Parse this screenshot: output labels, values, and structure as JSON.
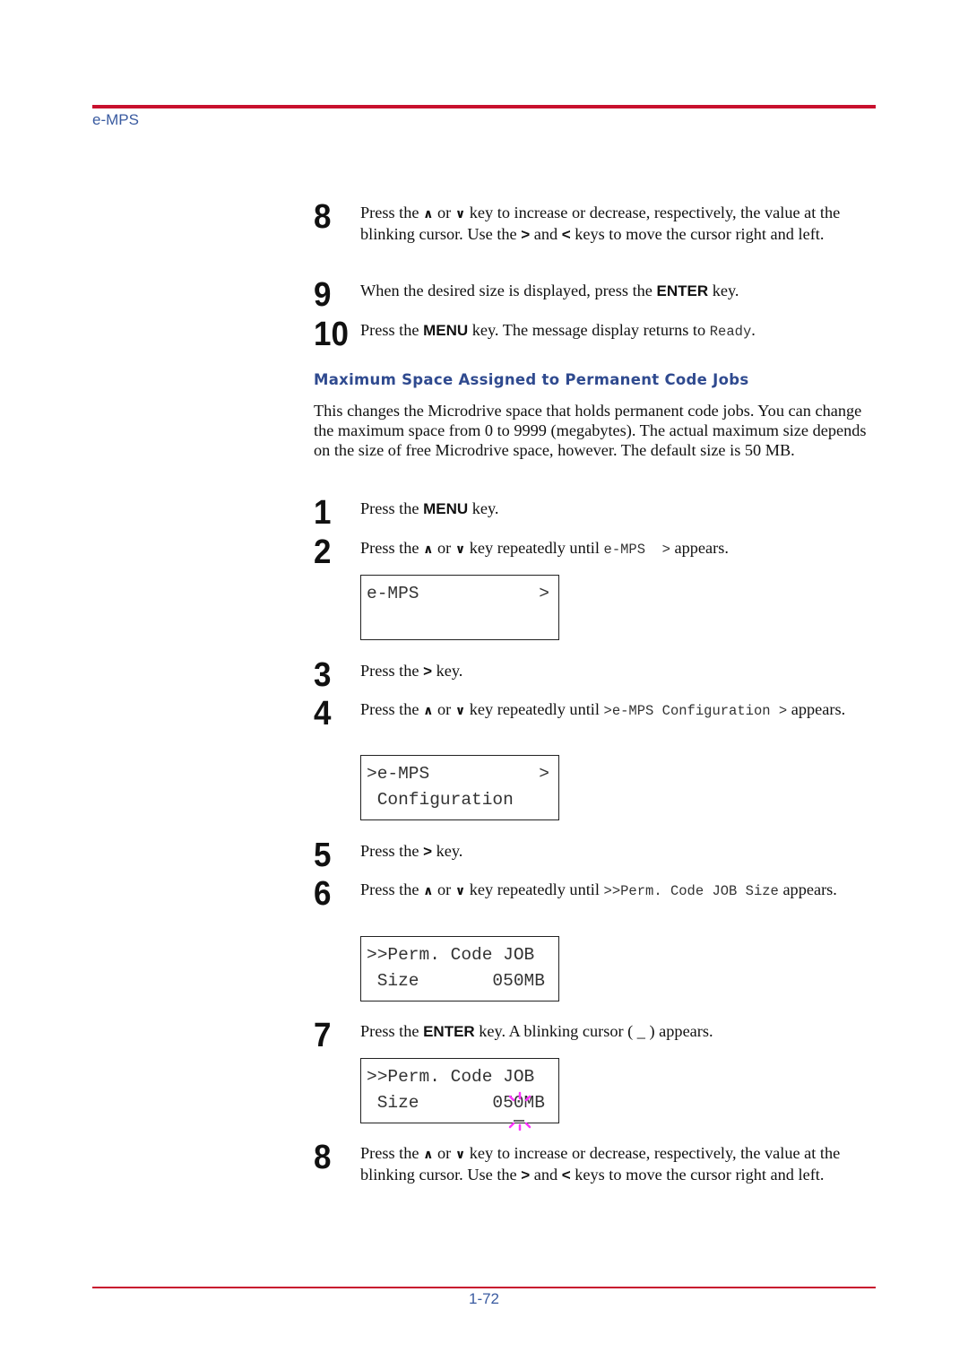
{
  "header": {
    "title": "e-MPS"
  },
  "footer": {
    "page": "1-72"
  },
  "colors": {
    "rule": "#c8102e",
    "accent": "#3a5ba0",
    "heading": "#2f4a8f",
    "cursor_blink": "#ff33ff"
  },
  "steps_top": [
    {
      "num": "8",
      "segments": [
        {
          "t": "Press the "
        },
        {
          "icon": "up-arrow",
          "g": "∧"
        },
        {
          "t": " or "
        },
        {
          "icon": "down-arrow",
          "g": "∨"
        },
        {
          "t": " key to increase or decrease, respectively, the value at the blinking cursor. Use the "
        },
        {
          "k": ">"
        },
        {
          "t": " and "
        },
        {
          "k": "<"
        },
        {
          "t": " keys to move the cursor right and left."
        }
      ]
    },
    {
      "num": "9",
      "segments": [
        {
          "t": "When the desired size is displayed, press the "
        },
        {
          "k": "ENTER"
        },
        {
          "t": " key."
        }
      ]
    },
    {
      "num": "10",
      "segments": [
        {
          "t": "Press the "
        },
        {
          "k": "MENU"
        },
        {
          "t": " key. The message display returns to "
        },
        {
          "m": "Ready"
        },
        {
          "t": "."
        }
      ]
    }
  ],
  "section": {
    "heading": "Maximum Space Assigned to Permanent Code Jobs",
    "paragraph": "This changes the Microdrive space that holds permanent code jobs. You can change the maximum space from 0 to 9999 (megabytes). The actual maximum size depends on the size of free Microdrive space, however. The default size is 50 MB."
  },
  "steps": [
    {
      "num": "1",
      "segments": [
        {
          "t": "Press the "
        },
        {
          "k": "MENU"
        },
        {
          "t": " key."
        }
      ]
    },
    {
      "num": "2",
      "segments": [
        {
          "t": "Press the "
        },
        {
          "icon": "up-arrow",
          "g": "∧"
        },
        {
          "t": " or "
        },
        {
          "icon": "down-arrow",
          "g": "∨"
        },
        {
          "t": " key repeatedly until "
        },
        {
          "m": "e-MPS  >"
        },
        {
          "t": " appears."
        }
      ]
    },
    {
      "num": "3",
      "segments": [
        {
          "t": "Press the "
        },
        {
          "k": ">"
        },
        {
          "t": " key."
        }
      ]
    },
    {
      "num": "4",
      "segments": [
        {
          "t": "Press the "
        },
        {
          "icon": "up-arrow",
          "g": "∧"
        },
        {
          "t": " or "
        },
        {
          "icon": "down-arrow",
          "g": "∨"
        },
        {
          "t": " key repeatedly until "
        },
        {
          "m": ">e-MPS Configuration >"
        },
        {
          "t": " appears."
        }
      ]
    },
    {
      "num": "5",
      "segments": [
        {
          "t": "Press the "
        },
        {
          "k": ">"
        },
        {
          "t": " key."
        }
      ]
    },
    {
      "num": "6",
      "segments": [
        {
          "t": "Press the "
        },
        {
          "icon": "up-arrow",
          "g": "∧"
        },
        {
          "t": " or "
        },
        {
          "icon": "down-arrow",
          "g": "∨"
        },
        {
          "t": " key repeatedly until "
        },
        {
          "m": ">>Perm. Code JOB Size"
        },
        {
          "t": " appears."
        }
      ]
    },
    {
      "num": "7",
      "segments": [
        {
          "t": "Press the "
        },
        {
          "k": "ENTER"
        },
        {
          "t": " key. A blinking cursor ( _ ) appears."
        }
      ]
    },
    {
      "num": "8",
      "segments": [
        {
          "t": "Press the "
        },
        {
          "icon": "up-arrow",
          "g": "∧"
        },
        {
          "t": " or "
        },
        {
          "icon": "down-arrow",
          "g": "∨"
        },
        {
          "t": " key to increase or decrease, respectively, the value at the blinking cursor. Use the "
        },
        {
          "k": ">"
        },
        {
          "t": " and "
        },
        {
          "k": "<"
        },
        {
          "t": " keys to move the cursor right and left."
        }
      ]
    }
  ],
  "displays": [
    {
      "line1": "e-MPS",
      "line2": "",
      "arrow": ">"
    },
    {
      "line1": ">e-MPS",
      "line2": " Configuration",
      "arrow": ">"
    },
    {
      "line1": ">>Perm. Code JOB",
      "line2": " Size       050MB",
      "arrow": ""
    },
    {
      "line1": ">>Perm. Code JOB",
      "line2": " Size       050MB",
      "arrow": ""
    }
  ]
}
